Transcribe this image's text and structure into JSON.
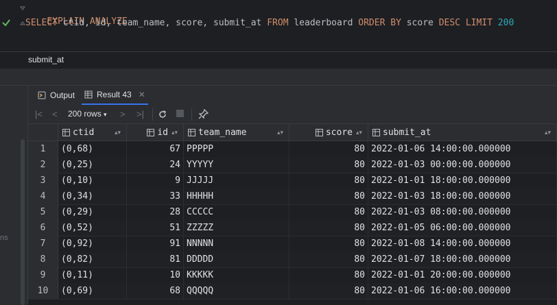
{
  "editor": {
    "line1": {
      "kw": "EXPLAIN ANALYZE"
    },
    "line2": {
      "select": "SELECT",
      "cols": " ctid, id, team_name, score, submit_at ",
      "from": "FROM",
      "table": " leaderboard ",
      "order": "ORDER BY",
      "orderCol": " score ",
      "desc": "DESC",
      "limit": " LIMIT",
      "limitVal": " 200"
    }
  },
  "breadcrumb": "submit_at",
  "tabs": [
    {
      "label": "Output",
      "icon": "output-icon"
    },
    {
      "label": "Result 43",
      "icon": "table-icon",
      "active": true
    }
  ],
  "toolbar": {
    "rows_label": "200 rows"
  },
  "left_strip_text": "ns",
  "table": {
    "columns": [
      "ctid",
      "id",
      "team_name",
      "score",
      "submit_at"
    ],
    "rows": [
      {
        "n": "1",
        "ctid": "(0,68)",
        "id": "67",
        "team": "PPPPP",
        "score": "80",
        "at": "2022-01-06 14:00:00.000000"
      },
      {
        "n": "2",
        "ctid": "(0,25)",
        "id": "24",
        "team": "YYYYY",
        "score": "80",
        "at": "2022-01-03 00:00:00.000000"
      },
      {
        "n": "3",
        "ctid": "(0,10)",
        "id": "9",
        "team": "JJJJJ",
        "score": "80",
        "at": "2022-01-01 18:00:00.000000"
      },
      {
        "n": "4",
        "ctid": "(0,34)",
        "id": "33",
        "team": "HHHHH",
        "score": "80",
        "at": "2022-01-03 18:00:00.000000"
      },
      {
        "n": "5",
        "ctid": "(0,29)",
        "id": "28",
        "team": "CCCCC",
        "score": "80",
        "at": "2022-01-03 08:00:00.000000"
      },
      {
        "n": "6",
        "ctid": "(0,52)",
        "id": "51",
        "team": "ZZZZZ",
        "score": "80",
        "at": "2022-01-05 06:00:00.000000"
      },
      {
        "n": "7",
        "ctid": "(0,92)",
        "id": "91",
        "team": "NNNNN",
        "score": "80",
        "at": "2022-01-08 14:00:00.000000"
      },
      {
        "n": "8",
        "ctid": "(0,82)",
        "id": "81",
        "team": "DDDDD",
        "score": "80",
        "at": "2022-01-07 18:00:00.000000"
      },
      {
        "n": "9",
        "ctid": "(0,11)",
        "id": "10",
        "team": "KKKKK",
        "score": "80",
        "at": "2022-01-01 20:00:00.000000"
      },
      {
        "n": "10",
        "ctid": "(0,69)",
        "id": "68",
        "team": "QQQQQ",
        "score": "80",
        "at": "2022-01-06 16:00:00.000000"
      }
    ]
  },
  "colors": {
    "keyword": "#cf8e6d",
    "number": "#2aacb8",
    "accent": "#3574f0",
    "ok": "#5fb865"
  }
}
